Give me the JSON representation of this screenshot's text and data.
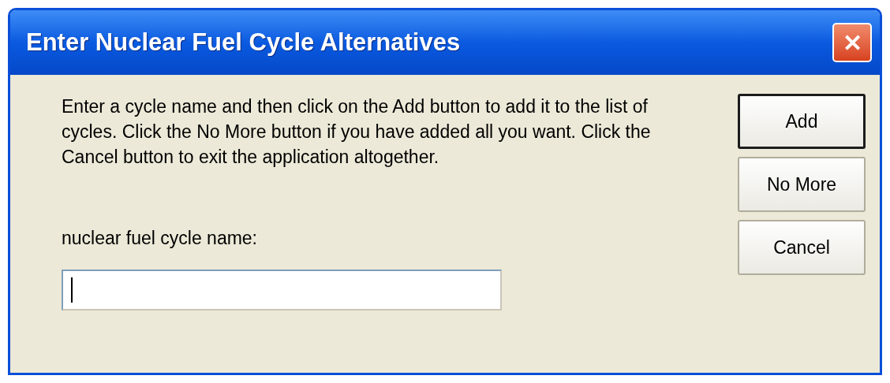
{
  "window": {
    "title": "Enter Nuclear Fuel Cycle Alternatives",
    "close_glyph": "✕"
  },
  "instructions": "Enter a cycle name and then click on the Add button to add it to the list of cycles.  Click the No More button if you have added all you want.  Click the Cancel button to exit the application altogether.",
  "field": {
    "label": "nuclear fuel cycle name:",
    "focused": true
  },
  "buttons": [
    {
      "label": "Add",
      "default": true
    },
    {
      "label": "No More",
      "default": false
    },
    {
      "label": "Cancel",
      "default": false
    }
  ]
}
